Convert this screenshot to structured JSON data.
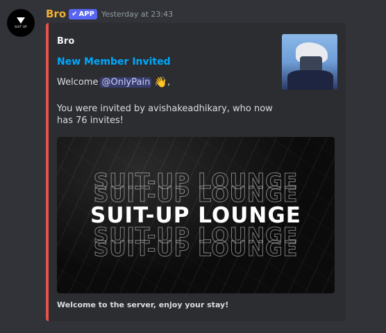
{
  "message": {
    "username": "Bro",
    "badge_check": "✔",
    "badge_label": "APP",
    "timestamp": "Yesterday at 23:43",
    "avatar_text": "SUIT UP"
  },
  "embed": {
    "accent_color": "#e5534b",
    "author": "Bro",
    "title": "New Member Invited",
    "welcome_prefix": "Welcome",
    "mention": "@OnlyPain",
    "wave_emoji": "👋",
    "welcome_suffix": ",",
    "description": "You were invited by avishakeadhikary, who now has 76 invites!",
    "banner_text": "SUIT-UP LOUNGE",
    "footer": "Welcome to the server, enjoy your stay!"
  }
}
